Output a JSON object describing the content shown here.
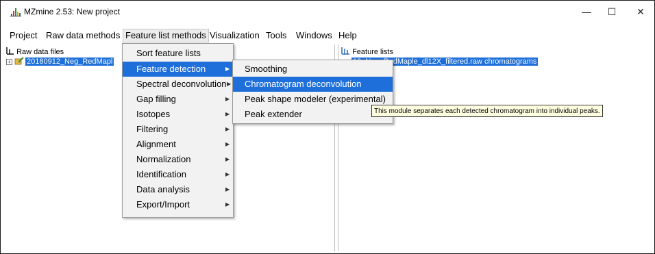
{
  "window": {
    "title": "MZmine 2.53: New project",
    "icon": "mzmine-chart-icon",
    "controls": {
      "minimize": "—",
      "maximize": "☐",
      "close": "✕"
    }
  },
  "menubar": {
    "items": [
      "Project",
      "Raw data methods",
      "Feature list methods",
      "Visualization",
      "Tools",
      "Windows",
      "Help"
    ],
    "active": "Feature list methods"
  },
  "left_panel": {
    "header": "Raw data files",
    "header_icon": "raw-data-icon",
    "rows": [
      {
        "expander": "+",
        "label": "20180912_Neg_RedMapl",
        "selected": true
      }
    ]
  },
  "right_panel": {
    "header": "Feature lists",
    "header_icon": "feature-list-icon",
    "rows": [
      {
        "label": "12_Neg_RedMaple_dl12X_filtered.raw chromatograms",
        "selected": true
      }
    ]
  },
  "feature_menu": {
    "items": [
      {
        "label": "Sort feature lists",
        "submenu": false
      },
      {
        "label": "Feature detection",
        "submenu": true,
        "highlighted": true
      },
      {
        "label": "Spectral deconvolution",
        "submenu": true
      },
      {
        "label": "Gap filling",
        "submenu": true
      },
      {
        "label": "Isotopes",
        "submenu": true
      },
      {
        "label": "Filtering",
        "submenu": true
      },
      {
        "label": "Alignment",
        "submenu": true
      },
      {
        "label": "Normalization",
        "submenu": true
      },
      {
        "label": "Identification",
        "submenu": true
      },
      {
        "label": "Data analysis",
        "submenu": true
      },
      {
        "label": "Export/Import",
        "submenu": true
      }
    ]
  },
  "detection_submenu": {
    "items": [
      {
        "label": "Smoothing"
      },
      {
        "label": "Chromatogram deconvolution",
        "highlighted": true
      },
      {
        "label": "Peak shape modeler (experimental)"
      },
      {
        "label": "Peak extender"
      }
    ]
  },
  "tooltip": {
    "text": "This module separates each detected chromatogram into individual peaks."
  },
  "colors": {
    "selection": "#1e6fd9",
    "menu_background": "#f2f2f2",
    "tooltip_background": "#ffffe1"
  }
}
